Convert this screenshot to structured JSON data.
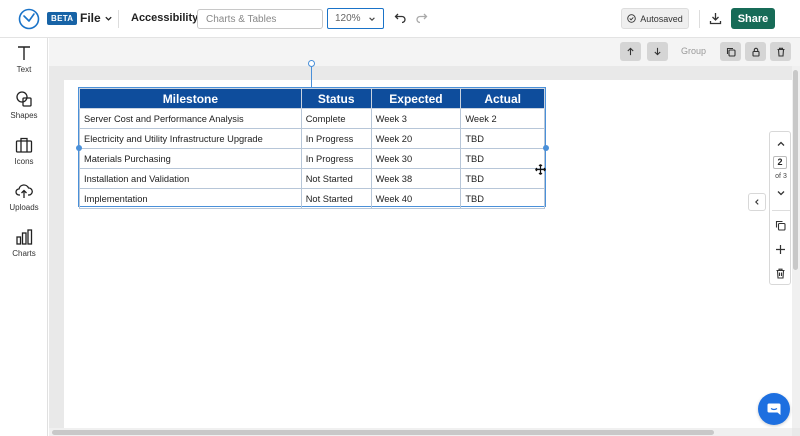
{
  "header": {
    "beta_badge": "BETA",
    "file_menu": "File",
    "accessibility": "Accessibility",
    "search_placeholder": "Charts & Tables",
    "zoom_level": "120%",
    "autosaved": "Autosaved",
    "share": "Share"
  },
  "sidebar": {
    "items": [
      {
        "label": "Text",
        "icon": "text-icon"
      },
      {
        "label": "Shapes",
        "icon": "shapes-icon"
      },
      {
        "label": "Icons",
        "icon": "briefcase-icon"
      },
      {
        "label": "Uploads",
        "icon": "cloud-upload-icon"
      },
      {
        "label": "Charts",
        "icon": "bar-chart-icon"
      }
    ]
  },
  "toolbar": {
    "group_label": "Group"
  },
  "table": {
    "headers": [
      "Milestone",
      "Status",
      "Expected",
      "Actual"
    ],
    "rows": [
      [
        "Server Cost and Performance Analysis",
        "Complete",
        "Week 3",
        "Week 2"
      ],
      [
        "Electricity and Utility Infrastructure Upgrade",
        "In Progress",
        "Week 20",
        "TBD"
      ],
      [
        "Materials Purchasing",
        "In Progress",
        "Week 30",
        "TBD"
      ],
      [
        "Installation and Validation",
        "Not Started",
        "Week 38",
        "TBD"
      ],
      [
        "Implementation",
        "Not Started",
        "Week 40",
        "TBD"
      ]
    ]
  },
  "page_nav": {
    "current": "2",
    "of_total": "of 3"
  },
  "colors": {
    "brand": "#1763a6",
    "share": "#176b57",
    "table_header": "#0e4d9c",
    "selection": "#4a90d9",
    "chat": "#1d6fe0"
  }
}
